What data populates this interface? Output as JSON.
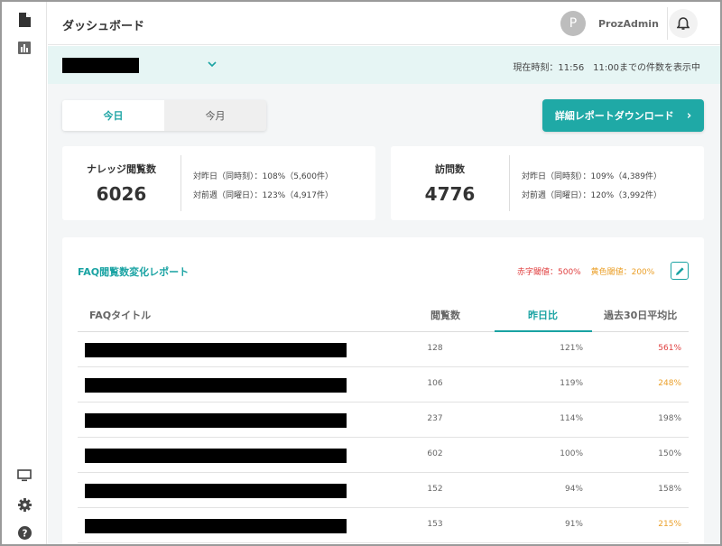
{
  "header": {
    "title": "ダッシュボード",
    "avatar_initial": "P",
    "username": "ProzAdmin"
  },
  "filterbar": {
    "selected_value": "",
    "time_info": "現在時刻：11:56　11:00までの件数を表示中"
  },
  "tabs": [
    {
      "label": "今日",
      "active": true
    },
    {
      "label": "今月",
      "active": false
    }
  ],
  "download_button": {
    "label": "詳細レポートダウンロード",
    "arrow": "›"
  },
  "stats": [
    {
      "label": "ナレッジ閲覧数",
      "value": "6026",
      "line1": "対昨日（同時刻）：108%（5,600件）",
      "line2": "対前週（同曜日）：123%（4,917件）"
    },
    {
      "label": "訪問数",
      "value": "4776",
      "line1": "対昨日（同時刻）：109%（4,389件）",
      "line2": "対前週（同曜日）：120%（3,992件）"
    }
  ],
  "faq": {
    "title": "FAQ閲覧数変化レポート",
    "red_threshold": "赤字閾値：500%",
    "yellow_threshold": "黄色閾値：200%",
    "columns": {
      "title": "FAQタイトル",
      "views": "閲覧数",
      "dod": "昨日比",
      "avg30": "過去30日平均比"
    },
    "rows": [
      {
        "views": "128",
        "dod": "121%",
        "avg30": "561%",
        "avg30_level": "red"
      },
      {
        "views": "106",
        "dod": "119%",
        "avg30": "248%",
        "avg30_level": "yellow"
      },
      {
        "views": "237",
        "dod": "114%",
        "avg30": "198%",
        "avg30_level": "normal"
      },
      {
        "views": "602",
        "dod": "100%",
        "avg30": "150%",
        "avg30_level": "normal"
      },
      {
        "views": "152",
        "dod": "94%",
        "avg30": "158%",
        "avg30_level": "normal"
      },
      {
        "views": "153",
        "dod": "91%",
        "avg30": "215%",
        "avg30_level": "yellow"
      }
    ]
  },
  "colors": {
    "accent": "#1aa3a3",
    "red": "#e04040",
    "yellow": "#eba02a",
    "normal": "#666666"
  },
  "icons": {
    "sidebar_top": [
      "document-icon",
      "bar-chart-icon"
    ],
    "sidebar_bottom": [
      "monitor-icon",
      "gear-icon",
      "help-icon"
    ],
    "header": [
      "bell-icon"
    ]
  }
}
